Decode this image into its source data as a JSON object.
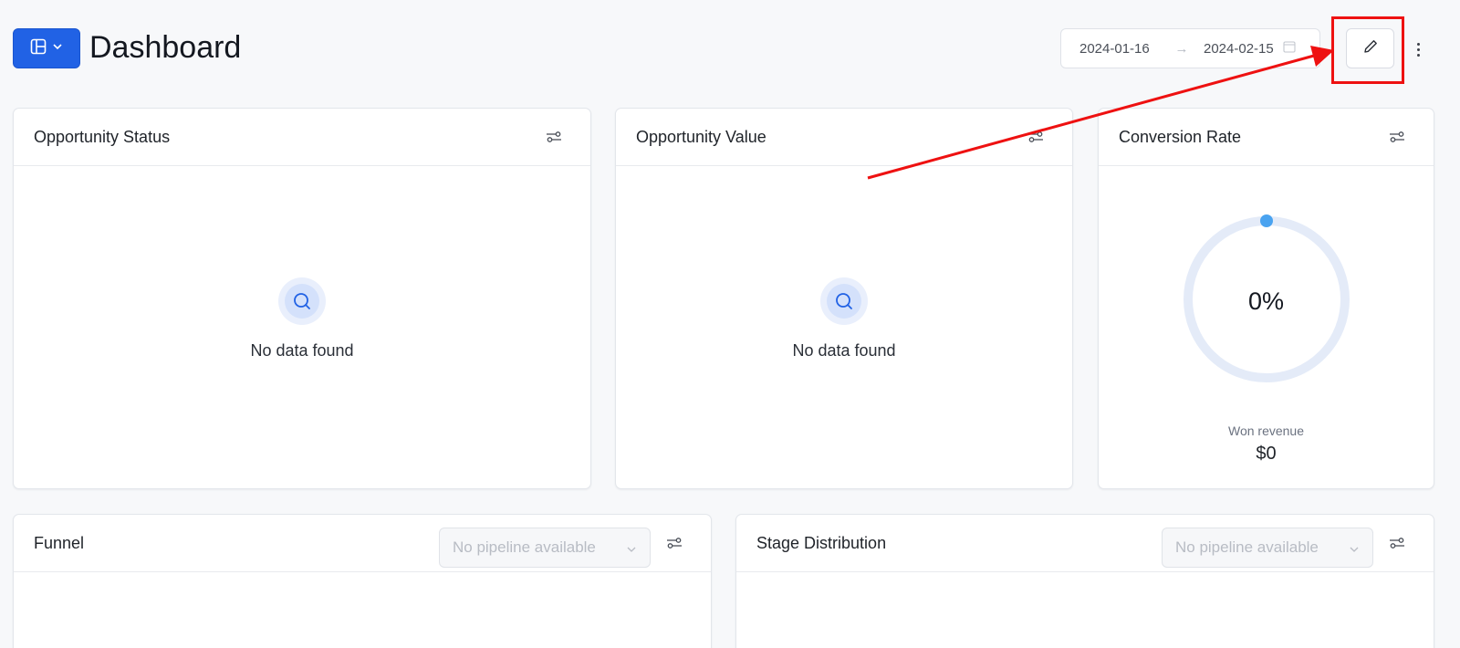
{
  "header": {
    "title": "Dashboard",
    "date_start": "2024-01-16",
    "date_separator": "→",
    "date_end": "2024-02-15"
  },
  "cards": {
    "opportunity_status": {
      "title": "Opportunity Status",
      "empty_text": "No data found"
    },
    "opportunity_value": {
      "title": "Opportunity Value",
      "empty_text": "No data found"
    },
    "conversion_rate": {
      "title": "Conversion Rate",
      "rate_display": "0%",
      "rate_value": 0,
      "won_label": "Won revenue",
      "won_value": "$0"
    },
    "funnel": {
      "title": "Funnel",
      "pipeline_placeholder": "No pipeline available"
    },
    "stage_distribution": {
      "title": "Stage Distribution",
      "pipeline_placeholder": "No pipeline available"
    }
  },
  "icons": {
    "layout": "layout-icon",
    "chevron": "chevron-down-icon",
    "calendar": "calendar-icon",
    "edit": "pencil-icon",
    "more": "more-vertical-icon",
    "filter": "filter-settings-icon",
    "search": "search-icon"
  },
  "colors": {
    "accent": "#2162e5",
    "gauge_track": "#e4ebf8",
    "gauge_dot": "#4aa3f0",
    "annotation": "#ee1111"
  }
}
